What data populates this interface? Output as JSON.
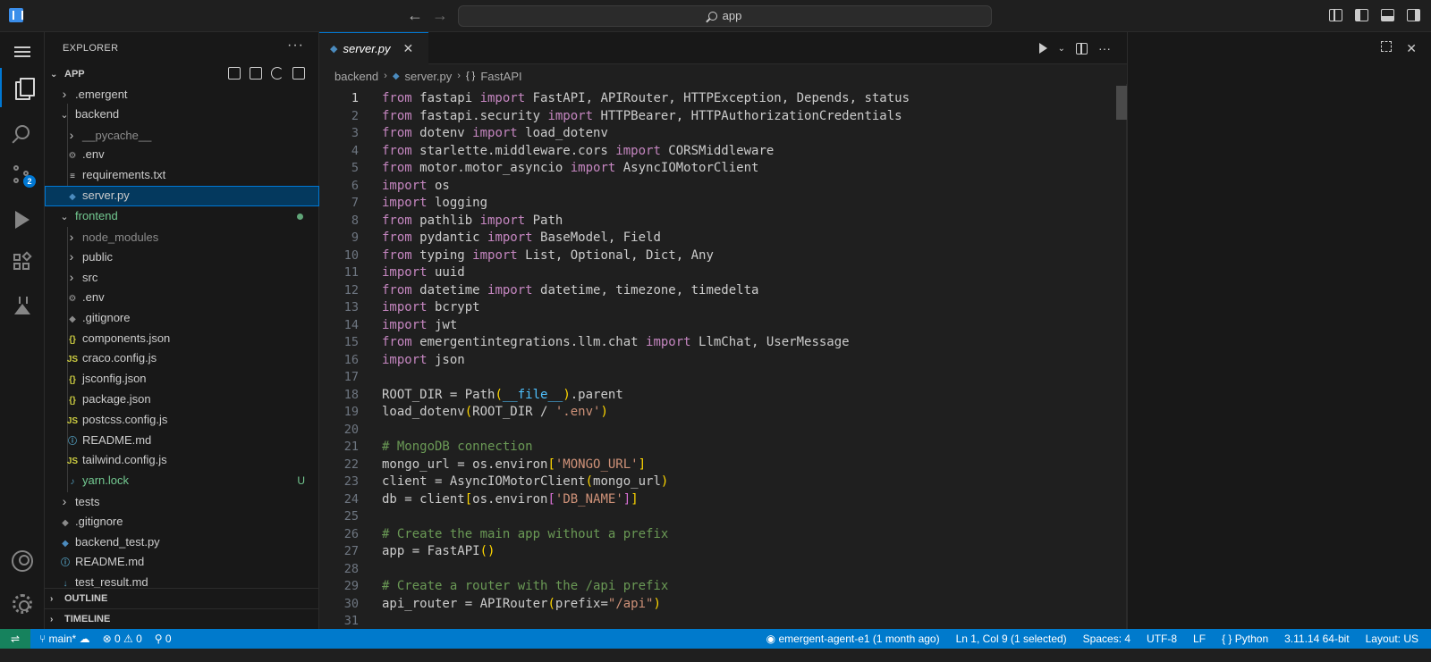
{
  "titlebar": {
    "search_text": "app"
  },
  "activity": {
    "scm_badge": "2"
  },
  "sidebar": {
    "title": "EXPLORER",
    "more": "···",
    "section": "APP",
    "outline": "OUTLINE",
    "timeline": "TIMELINE",
    "tree": [
      {
        "label": ".emergent",
        "type": "folder-closed",
        "depth": 0
      },
      {
        "label": "backend",
        "type": "folder-open",
        "depth": 0
      },
      {
        "label": "__pycache__",
        "type": "folder-closed",
        "depth": 1,
        "dim": true
      },
      {
        "label": ".env",
        "type": "env",
        "depth": 1
      },
      {
        "label": "requirements.txt",
        "type": "txt",
        "depth": 1
      },
      {
        "label": "server.py",
        "type": "py",
        "depth": 1,
        "selected": true
      },
      {
        "label": "frontend",
        "type": "folder-open",
        "depth": 0,
        "green": true,
        "dot": true
      },
      {
        "label": "node_modules",
        "type": "folder-closed",
        "depth": 1,
        "dim": true
      },
      {
        "label": "public",
        "type": "folder-closed",
        "depth": 1
      },
      {
        "label": "src",
        "type": "folder-closed",
        "depth": 1
      },
      {
        "label": ".env",
        "type": "env",
        "depth": 1
      },
      {
        "label": ".gitignore",
        "type": "git",
        "depth": 1
      },
      {
        "label": "components.json",
        "type": "json",
        "depth": 1
      },
      {
        "label": "craco.config.js",
        "type": "js",
        "depth": 1
      },
      {
        "label": "jsconfig.json",
        "type": "json",
        "depth": 1
      },
      {
        "label": "package.json",
        "type": "json",
        "depth": 1
      },
      {
        "label": "postcss.config.js",
        "type": "js",
        "depth": 1
      },
      {
        "label": "README.md",
        "type": "info",
        "depth": 1
      },
      {
        "label": "tailwind.config.js",
        "type": "js",
        "depth": 1
      },
      {
        "label": "yarn.lock",
        "type": "yarn",
        "depth": 1,
        "green": true,
        "deco": "U"
      },
      {
        "label": "tests",
        "type": "folder-closed",
        "depth": 0
      },
      {
        "label": ".gitignore",
        "type": "git",
        "depth": 0
      },
      {
        "label": "backend_test.py",
        "type": "py",
        "depth": 0
      },
      {
        "label": "README.md",
        "type": "info",
        "depth": 0
      },
      {
        "label": "test_result.md",
        "type": "md",
        "depth": 0
      }
    ]
  },
  "editor": {
    "tab_name": "server.py",
    "breadcrumb": [
      "backend",
      "server.py",
      "FastAPI"
    ],
    "lines": [
      "from fastapi import FastAPI, APIRouter, HTTPException, Depends, status",
      "from fastapi.security import HTTPBearer, HTTPAuthorizationCredentials",
      "from dotenv import load_dotenv",
      "from starlette.middleware.cors import CORSMiddleware",
      "from motor.motor_asyncio import AsyncIOMotorClient",
      "import os",
      "import logging",
      "from pathlib import Path",
      "from pydantic import BaseModel, Field",
      "from typing import List, Optional, Dict, Any",
      "import uuid",
      "from datetime import datetime, timezone, timedelta",
      "import bcrypt",
      "import jwt",
      "from emergentintegrations.llm.chat import LlmChat, UserMessage",
      "import json",
      "",
      "ROOT_DIR = Path(__file__).parent",
      "load_dotenv(ROOT_DIR / '.env')",
      "",
      "# MongoDB connection",
      "mongo_url = os.environ['MONGO_URL']",
      "client = AsyncIOMotorClient(mongo_url)",
      "db = client[os.environ['DB_NAME']]",
      "",
      "# Create the main app without a prefix",
      "app = FastAPI()",
      "",
      "# Create a router with the /api prefix",
      "api_router = APIRouter(prefix=\"/api\")",
      ""
    ]
  },
  "statusbar": {
    "branch": "main*",
    "problems": "⊗ 0 ⚠ 0",
    "ports": "0",
    "commit": "emergent-agent-e1 (1 month ago)",
    "position": "Ln 1, Col 9 (1 selected)",
    "spaces": "Spaces: 4",
    "encoding": "UTF-8",
    "eol": "LF",
    "language": "Python",
    "interpreter": "3.11.14 64-bit",
    "layout": "Layout: US"
  }
}
